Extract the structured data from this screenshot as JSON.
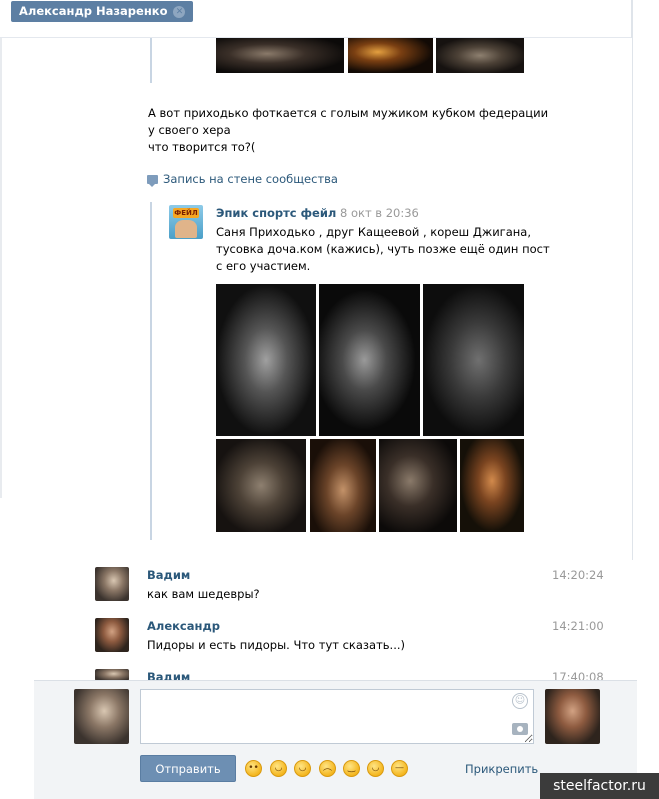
{
  "header": {
    "tab_title": "Александр Назаренко",
    "close_glyph": "✕"
  },
  "message": {
    "lines": [
      "А вот приходько фоткается с голым мужиком кубком федерации",
      "у своего хера",
      "что творится то?("
    ]
  },
  "wall_post": {
    "label": "Запись на стене сообщества",
    "group_name": "Эпик спортс фейл",
    "group_logo_text": "ФЕЙЛ",
    "date": "8 окт в 20:36",
    "text_lines": [
      "Саня Приходько , друг Кащеевой , кореш Джигана,",
      "тусовка доча.ком (кажись), чуть позже ещё один пост",
      "с его участием."
    ]
  },
  "chat": [
    {
      "author": "Вадим",
      "text": "как вам шедевры?",
      "time": "14:20:24"
    },
    {
      "author": "Александр",
      "text": "Пидоры и есть пидоры. Что тут сказать...)",
      "time": "14:21:00"
    },
    {
      "author": "Вадим",
      "text": "",
      "time": "17:40:08"
    }
  ],
  "composer": {
    "send_label": "Отправить",
    "attach_label": "Прикрепить",
    "smile_glyph": "☺",
    "emojis": [
      "🙄",
      "😄",
      "😂",
      "😟",
      "😏",
      "😆",
      "😑"
    ]
  },
  "watermark": "steelfactor.ru"
}
